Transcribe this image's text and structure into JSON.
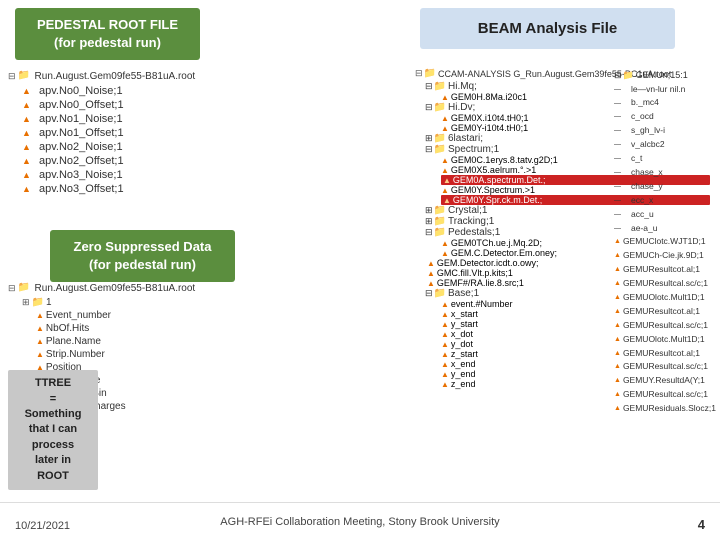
{
  "header": {
    "left_title": "PEDESTAL ROOT FILE\n(for pedestal run)",
    "right_title": "BEAM Analysis File"
  },
  "left_tree": {
    "root_label": "Run.August.Gem09fe55-B81uA.root",
    "items": [
      "apv.No0_Noise;1",
      "apv.No0_Offset;1",
      "apv.No1_Noise;1",
      "apv.No1_Offset;1",
      "apv.No2_Noise;1",
      "apv.No2_Offset;1",
      "apv.No3_Noise;1",
      "apv.No3_Offset;1"
    ]
  },
  "zero_suppressed": {
    "title": "Zero Suppressed Data\n(for pedestal run)"
  },
  "bottom_tree": {
    "root_label": "Run.August.Gem09fe55-B81uA.root",
    "folder": "1",
    "items": [
      "Event_number",
      "NbOf.Hits",
      "Plane.Name",
      "Strip.Number",
      "Position",
      "Max.Charge",
      "Max.Time.Bin",
      "Time.Bin.Charges"
    ]
  },
  "ttree": {
    "label": "TTREE\n=\nSomething\nthat I can\nprocess\nlater in\nROOT"
  },
  "right_tree": {
    "root_label": "CCAM-ANALYSIS G_Run.August.Gem39fe55-BC1uA.root",
    "folders": [
      {
        "name": "Hi.Mq;",
        "children": [
          "GEM0H.8Ma.i20c1"
        ]
      },
      {
        "name": "Hi.Dv;",
        "children": [
          "GEM0X.i10t4.tH0;1",
          "GEM0Y-i10t4.tH0;1"
        ]
      },
      {
        "name": "6lastari;",
        "children": []
      },
      {
        "name": "Spectrum;1",
        "children": [
          "GEM0C.1erys.8.tatv.g2D;1",
          "GEM0X5.aeI.rum.°.>1",
          "GEM0Aspectrum.Det.;",
          "GEM0YSpectrum.>1",
          "GEM0Y.Spr.ck.m.Det.;"
        ],
        "highlight": [
          2,
          4
        ]
      },
      {
        "name": "Crystal;1",
        "children": []
      },
      {
        "name": "Tracking;1",
        "children": []
      },
      {
        "name": "Pedestals;1",
        "children": [
          "GEM0TCh.ue.j.Mq.2D;",
          "GEM.C.Detector.Em.oney;"
        ]
      },
      {
        "name": "GEM.Detectoricdt.o.owy;",
        "children": []
      },
      {
        "name": "GMC.fill.Vlt.p.kits;1",
        "children": []
      },
      {
        "name": "GEMF#/RA.lie.8.src;1",
        "children": []
      },
      {
        "name": "Base;1",
        "children": [
          "event.#Number",
          "x_start",
          "y_start",
          "x_dot",
          "y_dot",
          "z_start",
          "x_end",
          "y_end",
          "z_end"
        ]
      }
    ]
  },
  "right_results": {
    "items": [
      "GEMUn;15:1",
      "le—vn-lur nil.n",
      "b._mc4",
      "c_ocd",
      "s_gh_lv-i",
      "v_alcbc2",
      "c_t",
      "chase_x",
      "chase_y",
      "ecc_x",
      "acc_u",
      "ae-a_u",
      "GEMUClotc.WJT1D;1",
      "GEMUCh-Cie.jk.9D;1",
      "GEMUResultcot.al;1",
      "GEMUResultcal.sc/c;1",
      "GEMUOlotc.Mult1D;1",
      "GEMUResultcot.al;1",
      "GEMUResultcal.sc/c;1",
      "GEMUOlotc.Mult1D;1",
      "GEMUResultcot.al;1",
      "GEMUResultcal.sc/c;1",
      "GEMUY.ResultdA(Y;1",
      "GEMUResultcal.sc/c;1",
      "GEMUResiduals.Slocz;1"
    ]
  },
  "footer": {
    "date": "10/21/2021",
    "conference": "AGH-RFEi Collaboration Meeting, Stony Brook University",
    "page": "4"
  }
}
